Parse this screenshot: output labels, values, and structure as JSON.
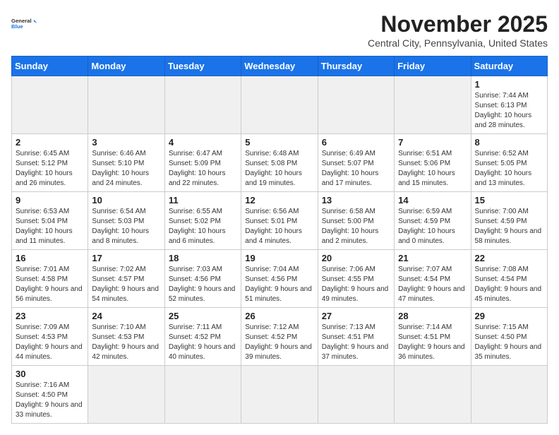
{
  "logo": {
    "text_general": "General",
    "text_blue": "Blue"
  },
  "title": "November 2025",
  "location": "Central City, Pennsylvania, United States",
  "days_of_week": [
    "Sunday",
    "Monday",
    "Tuesday",
    "Wednesday",
    "Thursday",
    "Friday",
    "Saturday"
  ],
  "weeks": [
    [
      {
        "day": "",
        "info": "",
        "empty": true
      },
      {
        "day": "",
        "info": "",
        "empty": true
      },
      {
        "day": "",
        "info": "",
        "empty": true
      },
      {
        "day": "",
        "info": "",
        "empty": true
      },
      {
        "day": "",
        "info": "",
        "empty": true
      },
      {
        "day": "",
        "info": "",
        "empty": true
      },
      {
        "day": "1",
        "info": "Sunrise: 7:44 AM\nSunset: 6:13 PM\nDaylight: 10 hours and 28 minutes."
      }
    ],
    [
      {
        "day": "2",
        "info": "Sunrise: 6:45 AM\nSunset: 5:12 PM\nDaylight: 10 hours and 26 minutes."
      },
      {
        "day": "3",
        "info": "Sunrise: 6:46 AM\nSunset: 5:10 PM\nDaylight: 10 hours and 24 minutes."
      },
      {
        "day": "4",
        "info": "Sunrise: 6:47 AM\nSunset: 5:09 PM\nDaylight: 10 hours and 22 minutes."
      },
      {
        "day": "5",
        "info": "Sunrise: 6:48 AM\nSunset: 5:08 PM\nDaylight: 10 hours and 19 minutes."
      },
      {
        "day": "6",
        "info": "Sunrise: 6:49 AM\nSunset: 5:07 PM\nDaylight: 10 hours and 17 minutes."
      },
      {
        "day": "7",
        "info": "Sunrise: 6:51 AM\nSunset: 5:06 PM\nDaylight: 10 hours and 15 minutes."
      },
      {
        "day": "8",
        "info": "Sunrise: 6:52 AM\nSunset: 5:05 PM\nDaylight: 10 hours and 13 minutes."
      }
    ],
    [
      {
        "day": "9",
        "info": "Sunrise: 6:53 AM\nSunset: 5:04 PM\nDaylight: 10 hours and 11 minutes."
      },
      {
        "day": "10",
        "info": "Sunrise: 6:54 AM\nSunset: 5:03 PM\nDaylight: 10 hours and 8 minutes."
      },
      {
        "day": "11",
        "info": "Sunrise: 6:55 AM\nSunset: 5:02 PM\nDaylight: 10 hours and 6 minutes."
      },
      {
        "day": "12",
        "info": "Sunrise: 6:56 AM\nSunset: 5:01 PM\nDaylight: 10 hours and 4 minutes."
      },
      {
        "day": "13",
        "info": "Sunrise: 6:58 AM\nSunset: 5:00 PM\nDaylight: 10 hours and 2 minutes."
      },
      {
        "day": "14",
        "info": "Sunrise: 6:59 AM\nSunset: 4:59 PM\nDaylight: 10 hours and 0 minutes."
      },
      {
        "day": "15",
        "info": "Sunrise: 7:00 AM\nSunset: 4:59 PM\nDaylight: 9 hours and 58 minutes."
      }
    ],
    [
      {
        "day": "16",
        "info": "Sunrise: 7:01 AM\nSunset: 4:58 PM\nDaylight: 9 hours and 56 minutes."
      },
      {
        "day": "17",
        "info": "Sunrise: 7:02 AM\nSunset: 4:57 PM\nDaylight: 9 hours and 54 minutes."
      },
      {
        "day": "18",
        "info": "Sunrise: 7:03 AM\nSunset: 4:56 PM\nDaylight: 9 hours and 52 minutes."
      },
      {
        "day": "19",
        "info": "Sunrise: 7:04 AM\nSunset: 4:56 PM\nDaylight: 9 hours and 51 minutes."
      },
      {
        "day": "20",
        "info": "Sunrise: 7:06 AM\nSunset: 4:55 PM\nDaylight: 9 hours and 49 minutes."
      },
      {
        "day": "21",
        "info": "Sunrise: 7:07 AM\nSunset: 4:54 PM\nDaylight: 9 hours and 47 minutes."
      },
      {
        "day": "22",
        "info": "Sunrise: 7:08 AM\nSunset: 4:54 PM\nDaylight: 9 hours and 45 minutes."
      }
    ],
    [
      {
        "day": "23",
        "info": "Sunrise: 7:09 AM\nSunset: 4:53 PM\nDaylight: 9 hours and 44 minutes."
      },
      {
        "day": "24",
        "info": "Sunrise: 7:10 AM\nSunset: 4:53 PM\nDaylight: 9 hours and 42 minutes."
      },
      {
        "day": "25",
        "info": "Sunrise: 7:11 AM\nSunset: 4:52 PM\nDaylight: 9 hours and 40 minutes."
      },
      {
        "day": "26",
        "info": "Sunrise: 7:12 AM\nSunset: 4:52 PM\nDaylight: 9 hours and 39 minutes."
      },
      {
        "day": "27",
        "info": "Sunrise: 7:13 AM\nSunset: 4:51 PM\nDaylight: 9 hours and 37 minutes."
      },
      {
        "day": "28",
        "info": "Sunrise: 7:14 AM\nSunset: 4:51 PM\nDaylight: 9 hours and 36 minutes."
      },
      {
        "day": "29",
        "info": "Sunrise: 7:15 AM\nSunset: 4:50 PM\nDaylight: 9 hours and 35 minutes."
      }
    ],
    [
      {
        "day": "30",
        "info": "Sunrise: 7:16 AM\nSunset: 4:50 PM\nDaylight: 9 hours and 33 minutes."
      },
      {
        "day": "",
        "info": "",
        "empty": true
      },
      {
        "day": "",
        "info": "",
        "empty": true
      },
      {
        "day": "",
        "info": "",
        "empty": true
      },
      {
        "day": "",
        "info": "",
        "empty": true
      },
      {
        "day": "",
        "info": "",
        "empty": true
      },
      {
        "day": "",
        "info": "",
        "empty": true
      }
    ]
  ]
}
